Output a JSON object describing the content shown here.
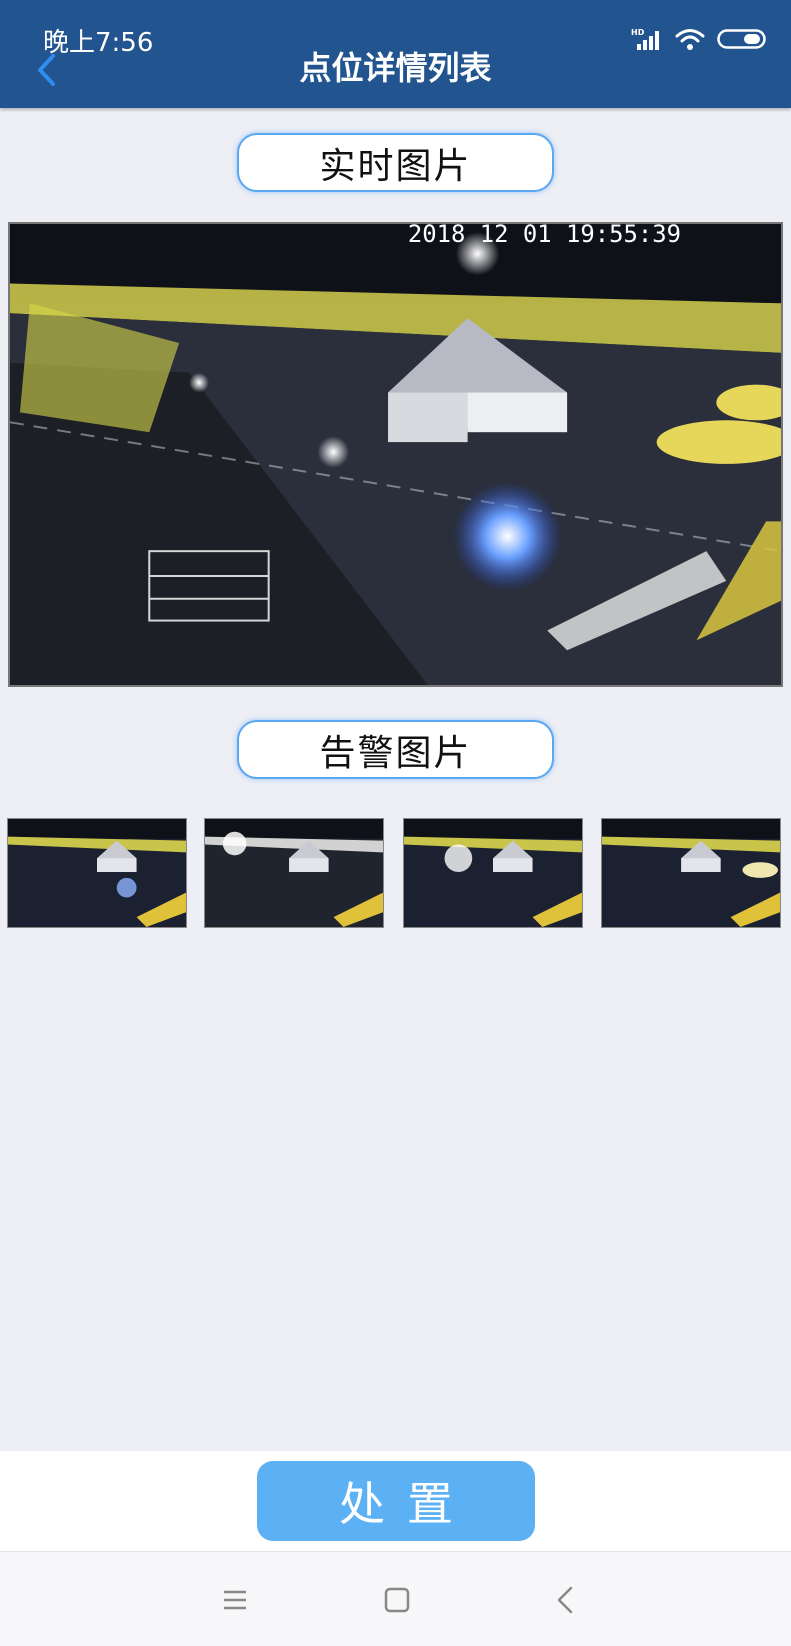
{
  "status_bar": {
    "time": "晚上7:56",
    "icons": [
      "hd-signal-icon",
      "wifi-icon",
      "battery-icon"
    ]
  },
  "header": {
    "title": "点位详情列表",
    "back_icon": "chevron-left-icon",
    "background": "#22548f"
  },
  "realtime": {
    "label": "实时图片",
    "timestamp_overlay": "2018 12 01 19:55:39"
  },
  "alarm": {
    "label": "告警图片",
    "thumbnails": [
      "alarm-image-1",
      "alarm-image-2",
      "alarm-image-3",
      "alarm-image-4"
    ]
  },
  "actions": {
    "handle_label": "处置",
    "button_color": "#5cb0f4"
  },
  "nav_bar": {
    "icons": [
      "menu-icon",
      "home-square-icon",
      "back-chevron-icon"
    ]
  }
}
